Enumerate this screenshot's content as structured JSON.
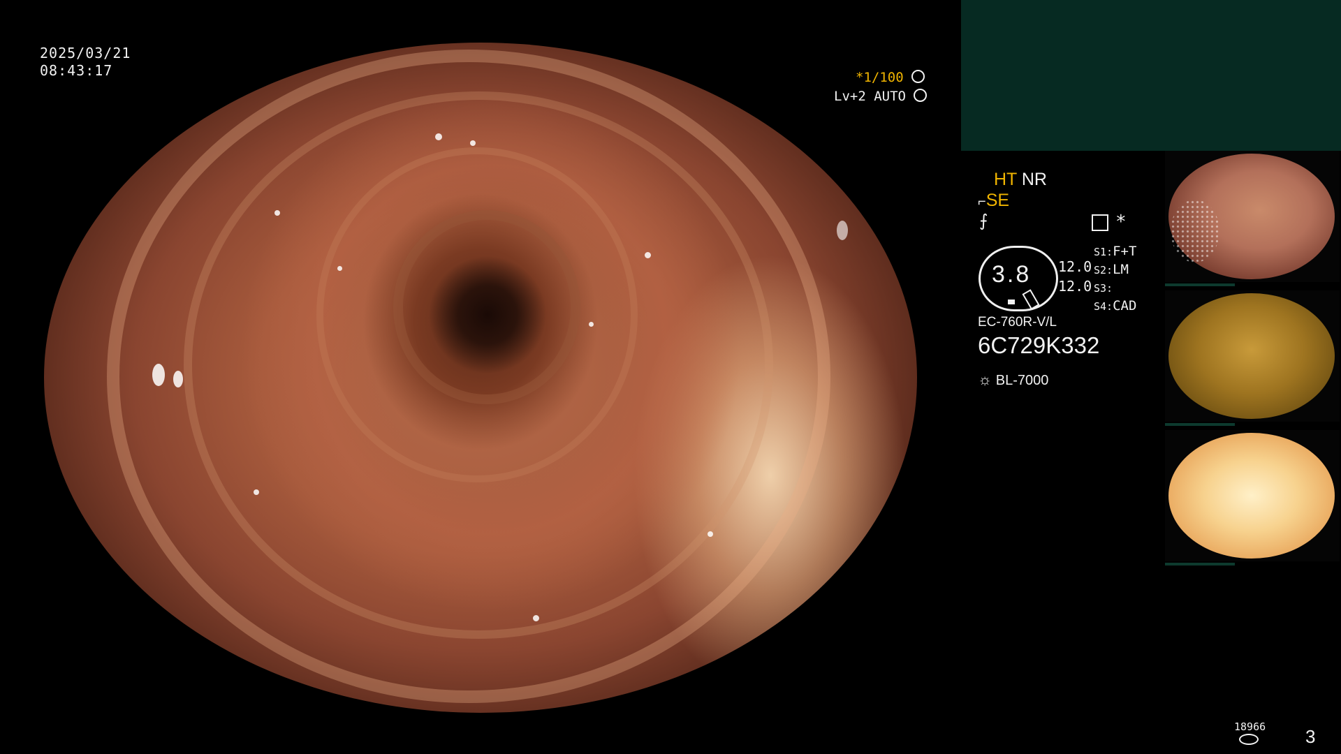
{
  "overlay": {
    "date": "2025/03/21",
    "time": "08:43:17",
    "shutter": "*1/100",
    "shutter_icon": "aperture-icon",
    "level_mode": "Lv+2 AUTO",
    "level_icon": "iris-icon"
  },
  "settings": {
    "ht": "HT",
    "nr": "NR",
    "se": "SE",
    "se_icon": "enhance-icon",
    "flash_icon": "flash-off-icon",
    "memo_icon": "notepad-icon",
    "asterisk": "*",
    "zoom_value": "3.8",
    "values": [
      "12.0",
      "12.0"
    ],
    "s_labels": [
      {
        "key": "S1:",
        "val": "F+T"
      },
      {
        "key": "S2:",
        "val": "LM"
      },
      {
        "key": "S3:",
        "val": ""
      },
      {
        "key": "S4:",
        "val": "CAD"
      }
    ]
  },
  "device": {
    "scope_model": "EC-760R-V/L",
    "serial": "6C729K332",
    "light_icon": "light-source-icon",
    "light_source": "BL-7000"
  },
  "footer": {
    "storage_count": "18966",
    "storage_icon": "storage-disk-icon",
    "page_number": "3"
  },
  "colors": {
    "accent_yellow": "#f0b400",
    "panel_green": "#062a22",
    "text_white": "#f2f2f2"
  }
}
